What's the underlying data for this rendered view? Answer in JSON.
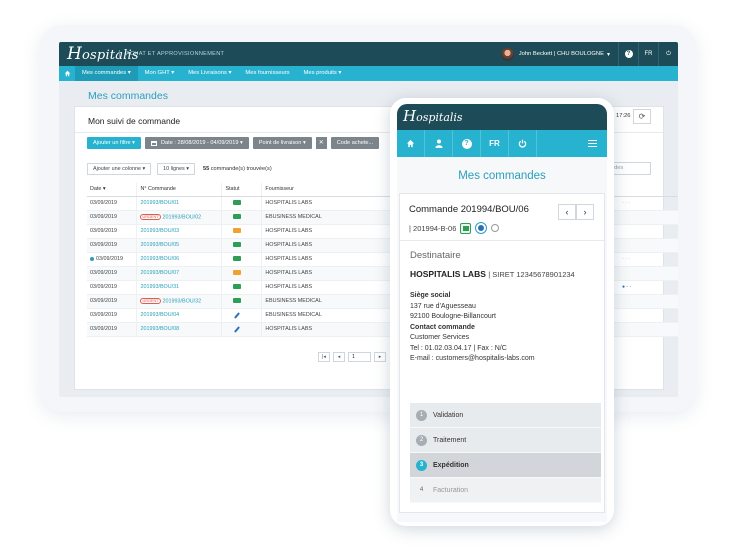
{
  "desktop": {
    "logo": {
      "cap": "H",
      "rest": "ospitalis"
    },
    "tagline": "ACHAT ET APPROVISIONNEMENT",
    "user": {
      "name": "John Beckett | CHU BOULOGNE",
      "chevron": "▾"
    },
    "toolbar": {
      "help": "?",
      "lang": "FR",
      "power": "⏻"
    },
    "nav": [
      "Mes commandes ▾",
      "Mon GHT ▾",
      "Mes Livraisons ▾",
      "Mes fournisseurs",
      "Mes produits ▾"
    ],
    "page_title": "Mes commandes",
    "card_title": "Mon suivi de commande",
    "filters": {
      "add": "Ajouter un filtre ▾",
      "date": "Date : 28/08/2019 - 04/09/2019 ▾",
      "point": "Point de livraison ▾",
      "clear": "✕",
      "code": "Code achete..."
    },
    "options": {
      "add_col": "Ajouter une colonne ▾",
      "lines": "10 lignes ▾",
      "found_count": "55",
      "found_text": "commande(s) trouvée(s)"
    },
    "time": "17:26",
    "search_fragment": "ndes",
    "columns": [
      "Date",
      "N° Commande",
      "Statut",
      "Fournisseur"
    ],
    "sort_arrow": "▾",
    "urgent_label": "URGENT",
    "rows": [
      {
        "date": "03/09/2019",
        "cmd": "201993/BOU/01",
        "urgent": false,
        "dot": false,
        "status": "truck-green",
        "supplier": "HOSPITALIS LABS"
      },
      {
        "date": "03/09/2019",
        "cmd": "201993/BOU/02",
        "urgent": true,
        "dot": false,
        "status": "mail-green",
        "supplier": "EBUSINESS MEDICAL"
      },
      {
        "date": "03/09/2019",
        "cmd": "201993/BOU/03",
        "urgent": false,
        "dot": false,
        "status": "truck-orange",
        "supplier": "HOSPITALIS LABS"
      },
      {
        "date": "03/09/2019",
        "cmd": "201993/BOU/05",
        "urgent": false,
        "dot": false,
        "status": "truck-green",
        "supplier": "HOSPITALIS LABS"
      },
      {
        "date": "03/09/2019",
        "cmd": "201993/BOU/06",
        "urgent": false,
        "dot": true,
        "status": "mail-green",
        "supplier": "HOSPITALIS LABS"
      },
      {
        "date": "03/09/2019",
        "cmd": "201993/BOU/07",
        "urgent": false,
        "dot": false,
        "status": "mail-orange",
        "supplier": "HOSPITALIS LABS"
      },
      {
        "date": "03/09/2019",
        "cmd": "201993/BOU/31",
        "urgent": false,
        "dot": false,
        "status": "truck-green",
        "supplier": "HOSPITALIS LABS"
      },
      {
        "date": "03/09/2019",
        "cmd": "201993/BOU/32",
        "urgent": true,
        "dot": false,
        "status": "truck-green",
        "supplier": "EBUSINESS MEDICAL"
      },
      {
        "date": "03/09/2019",
        "cmd": "201993/BOU/04",
        "urgent": false,
        "dot": false,
        "status": "pencil",
        "supplier": "EBUSINESS MEDICAL"
      },
      {
        "date": "03/09/2019",
        "cmd": "201993/BOU/08",
        "urgent": false,
        "dot": false,
        "status": "pencil",
        "supplier": "HOSPITALIS LABS"
      }
    ],
    "pager": {
      "first": "|◂",
      "prev": "◂",
      "page": "1",
      "next": "▸"
    }
  },
  "mobile": {
    "logo": {
      "cap": "H",
      "rest": "ospitalis"
    },
    "nav": {
      "lang": "FR",
      "help": "?"
    },
    "title": "Mes commandes",
    "order": {
      "title": "Commande 201994/BOU/06",
      "sub": "| 201994-B-06",
      "prev": "‹",
      "next": "›"
    },
    "recipient": {
      "heading": "Destinataire",
      "name": "HOSPITALIS LABS",
      "siret": "| SIRET 12345678901234",
      "seat_label": "Siège social",
      "addr1": "137 rue d'Aguesseau",
      "addr2": "92100 Boulogne-Billancourt",
      "contact_label": "Contact commande",
      "contact_name": "Customer Services",
      "tel": "Tel : 01.02.03.04.17 | Fax : N/C",
      "email": "E-mail : customers@hospitalis-labs.com"
    },
    "steps": [
      {
        "num": "1",
        "label": "Validation",
        "state": "done"
      },
      {
        "num": "2",
        "label": "Traitement",
        "state": "done"
      },
      {
        "num": "3",
        "label": "Expédition",
        "state": "active"
      },
      {
        "num": "4",
        "label": "Facturation",
        "state": "inactive"
      }
    ]
  },
  "colors": {
    "dark_teal": "#1d4b57",
    "cyan": "#27b3d0",
    "link_blue": "#2a9fbc",
    "green": "#2e9e56",
    "orange": "#f0a22e",
    "urgent_red": "#e25b4b"
  }
}
